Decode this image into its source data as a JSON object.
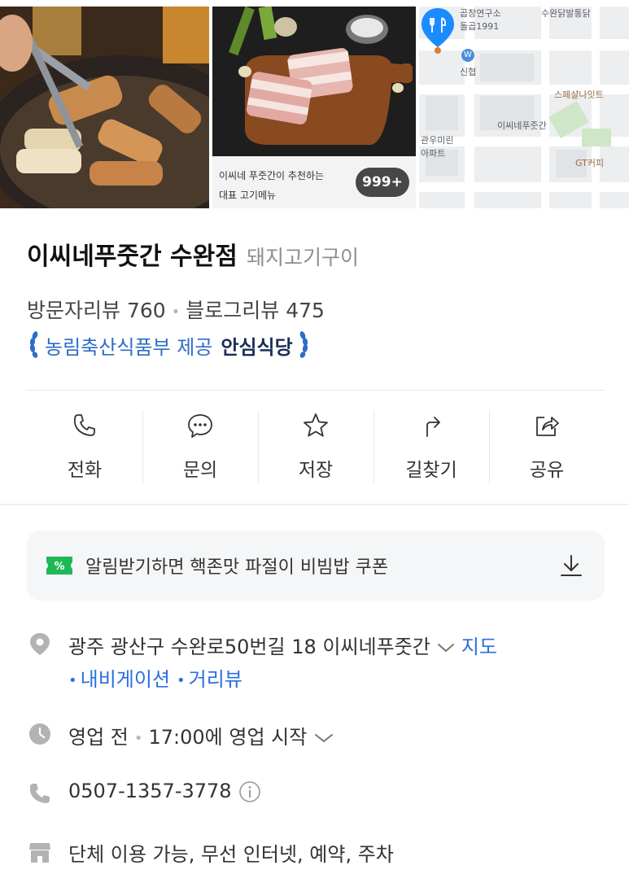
{
  "photos": {
    "caption_line1": "이씨네 푸줏간이 추천하는",
    "caption_line2": "대표 고기메뉴",
    "count_badge": "999+",
    "map_labels": [
      "곱창연구소",
      "돌곱1991",
      "수완닭발통닭",
      "신협",
      "스페샬나잇트",
      "이씨네푸줏간",
      "GT커피",
      "관우미린",
      "아파트"
    ]
  },
  "place": {
    "name": "이씨네푸줏간 수완점",
    "category": "돼지고기구이",
    "visitor_reviews": "방문자리뷰 760",
    "blog_reviews": "블로그리뷰 475",
    "cert_provider": "농림축산식품부 제공",
    "cert_name": "안심식당"
  },
  "actions": [
    {
      "label": "전화",
      "icon": "phone-icon"
    },
    {
      "label": "문의",
      "icon": "chat-icon"
    },
    {
      "label": "저장",
      "icon": "star-icon"
    },
    {
      "label": "길찾기",
      "icon": "directions-icon"
    },
    {
      "label": "공유",
      "icon": "share-icon"
    }
  ],
  "coupon": {
    "badge": "%",
    "text": "알림받기하면 핵존맛 파절이 비빔밥 쿠폰"
  },
  "info": {
    "address": "광주 광산구 수완로50번길 18 이씨네푸줏간",
    "map_link": "지도",
    "navigation_link": "내비게이션",
    "street_view_link": "거리뷰",
    "hours_status": "영업 전",
    "hours_detail": "17:00에 영업 시작",
    "phone": "0507-1357-3778",
    "amenities": "단체 이용 가능, 무선 인터넷, 예약, 주차"
  },
  "colors": {
    "link_blue": "#2b6ee0",
    "cert_blue": "#2e6cc9",
    "coupon_green": "#1eb854",
    "map_pin_blue": "#1a8cff"
  }
}
